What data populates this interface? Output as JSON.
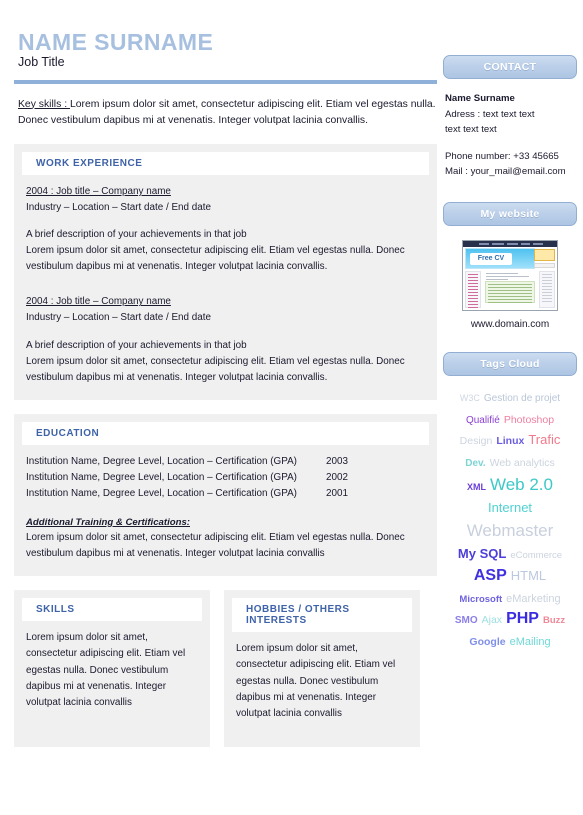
{
  "header": {
    "name": "NAME SURNAME",
    "job_title": "Job Title",
    "name_color": "#a8c0e0",
    "rule_color": "#8fb0d8",
    "key_skills_label": "Key skills : ",
    "key_skills_text": "Lorem ipsum dolor sit amet, consectetur adipiscing elit. Etiam vel egestas nulla. Donec vestibulum dapibus mi at venenatis. Integer volutpat lacinia convallis."
  },
  "work_experience": {
    "heading": "WORK EXPERIENCE",
    "jobs": [
      {
        "title_line": "2004 : Job title – Company name",
        "meta_line": "Industry – Location – Start date / End date",
        "achievement_line": "A brief description of your achievements in that job",
        "description": "Lorem ipsum dolor sit amet, consectetur adipiscing elit. Etiam vel egestas nulla. Donec vestibulum dapibus mi at venenatis. Integer volutpat lacinia convallis."
      },
      {
        "title_line": "2004 : Job title – Company name",
        "meta_line": "Industry – Location – Start date / End date",
        "achievement_line": "A brief description of your achievements in that job",
        "description": "Lorem ipsum dolor sit amet, consectetur adipiscing elit. Etiam vel egestas nulla. Donec vestibulum dapibus mi at venenatis. Integer volutpat lacinia convallis."
      }
    ]
  },
  "education": {
    "heading": "EDUCATION",
    "entries": [
      {
        "institution": "Institution Name, Degree Level, Location – Certification (GPA)",
        "year": "2003"
      },
      {
        "institution": "Institution Name, Degree Level, Location – Certification (GPA)",
        "year": "2002"
      },
      {
        "institution": "Institution Name, Degree Level, Location – Certification (GPA)",
        "year": "2001"
      }
    ],
    "additional_heading": "Additional Training & Certifications:",
    "additional_text": "Lorem ipsum dolor sit amet, consectetur adipiscing elit. Etiam vel egestas nulla. Donec vestibulum dapibus mi at venenatis. Integer volutpat lacinia convallis"
  },
  "skills": {
    "heading": "SKILLS",
    "text": "Lorem ipsum dolor sit amet, consectetur adipiscing elit. Etiam vel egestas nulla. Donec vestibulum dapibus mi at venenatis. Integer volutpat lacinia convallis"
  },
  "hobbies": {
    "heading": "HOBBIES / OTHERS INTERESTS",
    "text": "Lorem ipsum dolor sit amet, consectetur adipiscing elit. Etiam vel egestas nulla. Donec vestibulum dapibus mi at venenatis. Integer volutpat lacinia convallis"
  },
  "sidebar": {
    "contact": {
      "heading": "CONTACT",
      "name": "Name Surname",
      "address_line1": "Adress : text text text",
      "address_line2": "text text text",
      "phone": "Phone number: +33 45665",
      "mail": "Mail : your_mail@email.com"
    },
    "website": {
      "heading": "My website",
      "thumbnail_logo_text": "Free CV",
      "url": "www.domain.com"
    },
    "tags_cloud": {
      "heading": "Tags Cloud",
      "rows": [
        [
          {
            "label": "W3C",
            "size": 9,
            "color": "#cfd6e2",
            "weight": "normal"
          },
          {
            "label": "Gestion de projet",
            "size": 10,
            "color": "#b9c6d9",
            "weight": "normal"
          }
        ],
        [
          {
            "label": "Qualifié",
            "size": 10,
            "color": "#8b3fd1",
            "weight": "normal"
          },
          {
            "label": "Photoshop",
            "size": 10.5,
            "color": "#ef7fa0",
            "weight": "normal"
          }
        ],
        [
          {
            "label": "Design",
            "size": 10.5,
            "color": "#cdd4e0",
            "weight": "normal"
          },
          {
            "label": "Linux",
            "size": 10.5,
            "color": "#6a5de0",
            "weight": "bold"
          },
          {
            "label": "Trafic",
            "size": 13,
            "color": "#f07a8c",
            "weight": "normal"
          }
        ],
        [
          {
            "label": "Dev.",
            "size": 10,
            "color": "#7fd4d4",
            "weight": "bold"
          },
          {
            "label": "Web analytics",
            "size": 10.5,
            "color": "#ccd3de",
            "weight": "normal"
          }
        ],
        [
          {
            "label": "XML",
            "size": 9,
            "color": "#6a3fd8",
            "weight": "bold"
          },
          {
            "label": "Web 2.0",
            "size": 17,
            "color": "#3dc8c8",
            "weight": "normal"
          }
        ],
        [
          {
            "label": "Internet",
            "size": 13,
            "color": "#4fd2d2",
            "weight": "normal"
          }
        ],
        [
          {
            "label": "Webmaster",
            "size": 17,
            "color": "#c8d0de",
            "weight": "normal"
          }
        ],
        [
          {
            "label": "My SQL",
            "size": 13,
            "color": "#4b3fd8",
            "weight": "bold"
          },
          {
            "label": "eCommerce",
            "size": 9.5,
            "color": "#cdd4e0",
            "weight": "normal"
          }
        ],
        [
          {
            "label": "ASP",
            "size": 16,
            "color": "#4030e0",
            "weight": "bold"
          },
          {
            "label": "HTML",
            "size": 13,
            "color": "#bcc8de",
            "weight": "normal"
          }
        ],
        [
          {
            "label": "Microsoft",
            "size": 9.5,
            "color": "#6f63e0",
            "weight": "bold"
          },
          {
            "label": "eMarketing",
            "size": 11,
            "color": "#ccd3de",
            "weight": "normal"
          }
        ],
        [
          {
            "label": "SMO",
            "size": 10,
            "color": "#8b7fe8",
            "weight": "bold"
          },
          {
            "label": "Ajax",
            "size": 10.5,
            "color": "#9ee0e0",
            "weight": "normal"
          },
          {
            "label": "PHP",
            "size": 16,
            "color": "#3a2ce0",
            "weight": "bold"
          },
          {
            "label": "Buzz",
            "size": 9.5,
            "color": "#f08898",
            "weight": "bold"
          }
        ],
        [
          {
            "label": "Google",
            "size": 10.5,
            "color": "#7f8fe8",
            "weight": "bold"
          },
          {
            "label": "eMailing",
            "size": 11,
            "color": "#6fd8d8",
            "weight": "normal"
          }
        ]
      ]
    }
  }
}
